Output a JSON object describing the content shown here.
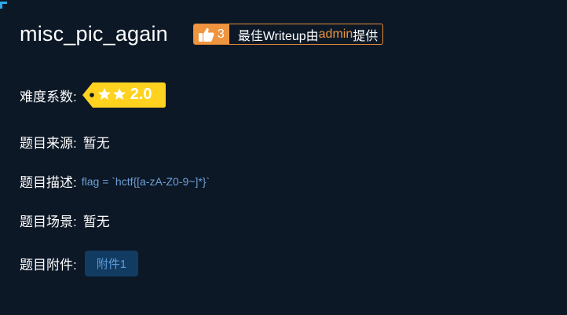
{
  "challenge": {
    "title": "misc_pic_again"
  },
  "writeup_badge": {
    "like_count": "3",
    "text_before": "最佳Writeup由",
    "user": "admin",
    "text_after": "提供"
  },
  "fields": {
    "difficulty_label": "难度系数:",
    "difficulty_value": "2.0",
    "difficulty_stars": 2,
    "source_label": "题目来源:",
    "source_value": "暂无",
    "description_label": "题目描述:",
    "description_value": "flag = `hctf{[a-zA-Z0-9~]*}`",
    "scene_label": "题目场景:",
    "scene_value": "暂无",
    "attachment_label": "题目附件:",
    "attachment_button": "附件1"
  },
  "colors": {
    "background": "#0c1826",
    "accent_orange": "#f0953f",
    "difficulty_gold": "#ffd21f",
    "description_blue": "#6ea0d6",
    "attachment_bg": "#123b62"
  }
}
